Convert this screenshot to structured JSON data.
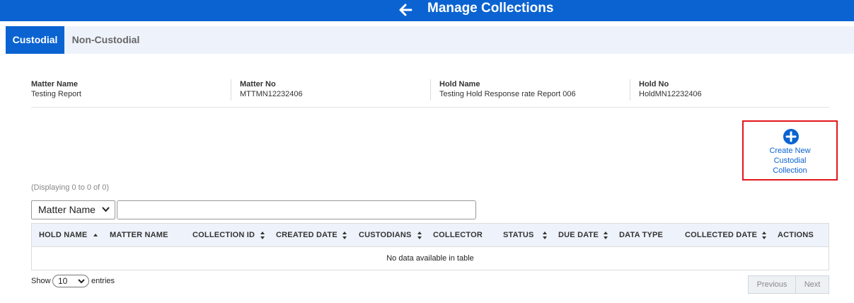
{
  "header": {
    "title": "Manage Collections",
    "back_icon": "arrow-left-icon",
    "color": "#0a63d1"
  },
  "tabs": [
    {
      "label": "Custodial",
      "active": true
    },
    {
      "label": "Non-Custodial",
      "active": false
    }
  ],
  "info": [
    {
      "label": "Matter Name",
      "value": "Testing Report"
    },
    {
      "label": "Matter No",
      "value": "MTTMN12232406"
    },
    {
      "label": "Hold Name",
      "value": "Testing Hold Response rate Report 006"
    },
    {
      "label": "Hold No",
      "value": "HoldMN12232406"
    }
  ],
  "create_button": {
    "label": "Create New Custodial Collection",
    "icon": "plus-circle-icon",
    "highlight_color": "#e3161b"
  },
  "table": {
    "displaying": "(Displaying 0 to 0 of 0)",
    "filter_selected": "Matter Name",
    "filter_value": "",
    "columns": [
      "HOLD NAME",
      "MATTER NAME",
      "COLLECTION ID",
      "CREATED DATE",
      "CUSTODIANS",
      "COLLECTOR",
      "STATUS",
      "DUE DATE",
      "DATA TYPE",
      "COLLECTED DATE",
      "ACTIONS"
    ],
    "empty_message": "No data available in table"
  },
  "footer": {
    "show_label": "Show",
    "entries_value": "10",
    "entries_label": "entries",
    "previous": "Previous",
    "next": "Next"
  }
}
